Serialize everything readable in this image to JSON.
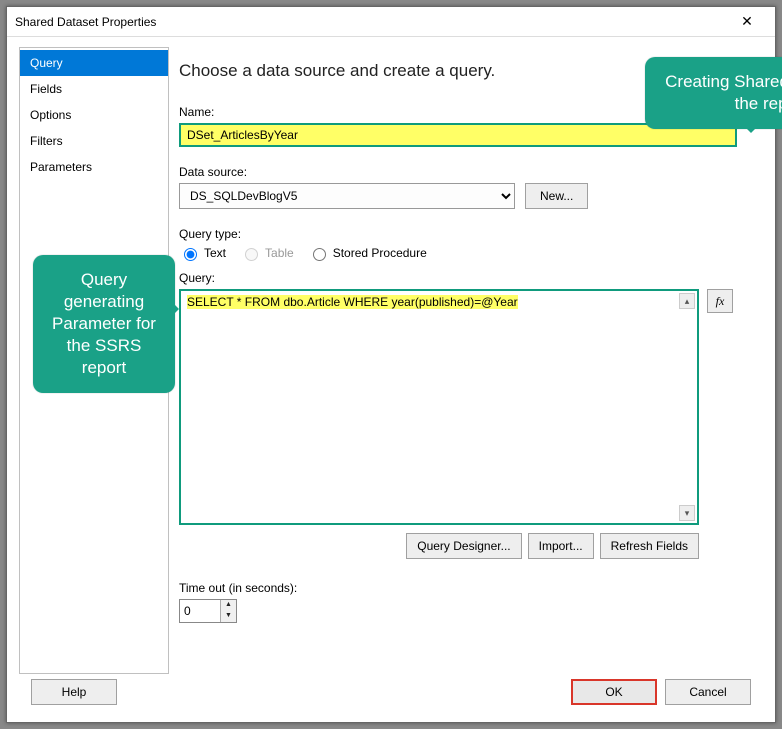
{
  "window": {
    "title": "Shared Dataset Properties",
    "close_label": "✕"
  },
  "sidebar": {
    "items": [
      {
        "label": "Query",
        "selected": true
      },
      {
        "label": "Fields"
      },
      {
        "label": "Options"
      },
      {
        "label": "Filters"
      },
      {
        "label": "Parameters"
      }
    ]
  },
  "main": {
    "heading": "Choose a data source and create a query.",
    "name_label": "Name:",
    "name_value": "DSet_ArticlesByYear",
    "data_source_label": "Data source:",
    "data_source_value": "DS_SQLDevBlogV5",
    "new_button": "New...",
    "query_type_label": "Query type:",
    "query_type_options": {
      "text": "Text",
      "table": "Table",
      "stored_procedure": "Stored Procedure"
    },
    "query_label": "Query:",
    "query_prefix": "SELECT * FROM dbo.Article WHERE year(published)=",
    "query_param": "@Year",
    "fx_label": "fx",
    "query_buttons": {
      "designer": "Query Designer...",
      "import": "Import...",
      "refresh": "Refresh Fields"
    },
    "timeout_label": "Time out (in seconds):",
    "timeout_value": "0"
  },
  "footer": {
    "help": "Help",
    "ok": "OK",
    "cancel": "Cancel"
  },
  "callouts": {
    "top": "Creating Shared Dataset for the report",
    "left": "Query generating Parameter for the SSRS report"
  }
}
